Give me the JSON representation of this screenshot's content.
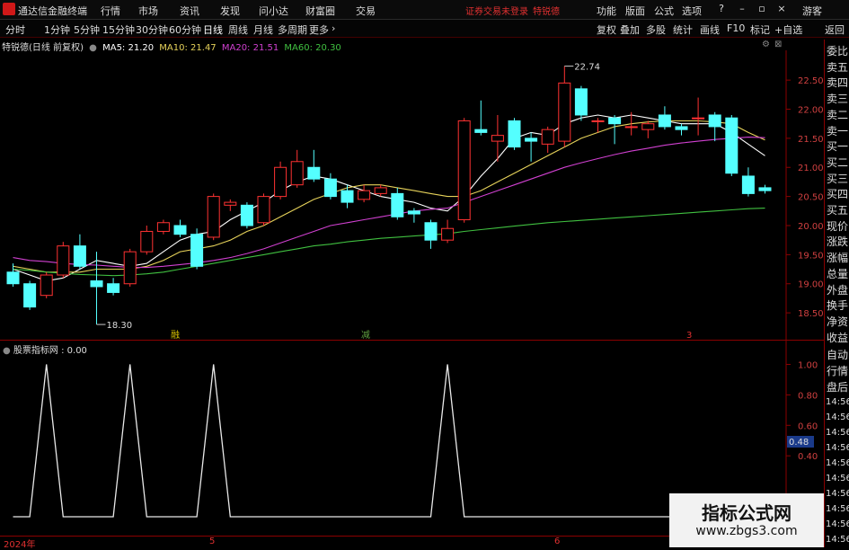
{
  "app": {
    "name": "通达信金融终端",
    "menu": [
      "行情",
      "市场",
      "资讯",
      "发现",
      "问小达",
      "财富圈",
      "交易"
    ],
    "warning": "证券交易未登录",
    "stock_short": "特锐德",
    "right_menu": [
      "功能",
      "版面",
      "公式",
      "选项"
    ],
    "guest": "游客"
  },
  "toolbar": {
    "timeframes": [
      "分时",
      "1分钟",
      "5分钟",
      "15分钟",
      "30分钟",
      "60分钟",
      "日线",
      "周线",
      "月线",
      "多周期",
      "更多"
    ],
    "active": "日线",
    "right": [
      "复权",
      "叠加",
      "多股",
      "统计",
      "画线",
      "F10",
      "标记",
      "+自选",
      "返回"
    ]
  },
  "legend": {
    "title": "特锐德(日线 前复权)",
    "ma5": "MA5: 21.20",
    "ma10": "MA10: 21.47",
    "ma20": "MA20: 21.51",
    "ma60": "MA60: 20.30",
    "colors": {
      "ma5": "#ffffff",
      "ma10": "#e6d25a",
      "ma20": "#d040d0",
      "ma60": "#40c040"
    }
  },
  "price_axis": [
    "22.50",
    "22.00",
    "21.50",
    "21.00",
    "20.50",
    "20.00",
    "19.50",
    "19.00",
    "18.50"
  ],
  "annotations": {
    "high": "22.74",
    "low": "18.30"
  },
  "event_marks": [
    {
      "label": "融",
      "color": "#d8c000"
    },
    {
      "label": "减",
      "color": "#60a040"
    },
    {
      "label": "3",
      "color": "#e03030"
    }
  ],
  "indicator": {
    "title": "股票指标网 : 0.00",
    "axis": [
      "1.00",
      "0.80",
      "0.60",
      "0.40"
    ],
    "current_value": "0.48"
  },
  "date_axis": [
    "2024年",
    "5",
    "6"
  ],
  "sidebar": {
    "top_labels": [
      "委比",
      "卖五",
      "卖四",
      "卖三",
      "卖二",
      "卖一",
      "买一",
      "买二",
      "买三",
      "买四",
      "买五",
      "现价",
      "涨跌",
      "涨幅",
      "总量",
      "外盘",
      "换手",
      "净资",
      "收益"
    ],
    "bottom_labels": [
      "自动",
      "行情",
      "盘后"
    ],
    "times": [
      "14:56",
      "14:56",
      "14:56",
      "14:56",
      "14:56",
      "14:56",
      "14:56",
      "14:56",
      "14:56",
      "14:56"
    ]
  },
  "watermark": {
    "line1": "指标公式网",
    "line2": "www.zbgs3.com"
  },
  "chart_data": {
    "type": "candlestick",
    "ylim": [
      18.1,
      22.95
    ],
    "candles": [
      {
        "o": 19.2,
        "c": 19.0,
        "h": 19.35,
        "l": 18.95
      },
      {
        "o": 19.0,
        "c": 18.6,
        "h": 19.05,
        "l": 18.55
      },
      {
        "o": 18.8,
        "c": 19.15,
        "h": 19.2,
        "l": 18.75
      },
      {
        "o": 19.15,
        "c": 19.65,
        "h": 19.72,
        "l": 19.1
      },
      {
        "o": 19.65,
        "c": 19.3,
        "h": 19.85,
        "l": 19.25
      },
      {
        "o": 19.05,
        "c": 18.95,
        "h": 19.55,
        "l": 18.3
      },
      {
        "o": 19.0,
        "c": 18.85,
        "h": 19.1,
        "l": 18.8
      },
      {
        "o": 19.0,
        "c": 19.55,
        "h": 19.6,
        "l": 18.95
      },
      {
        "o": 19.55,
        "c": 19.9,
        "h": 20.0,
        "l": 19.5
      },
      {
        "o": 19.9,
        "c": 20.05,
        "h": 20.1,
        "l": 19.85
      },
      {
        "o": 20.0,
        "c": 19.85,
        "h": 20.1,
        "l": 19.8
      },
      {
        "o": 19.85,
        "c": 19.3,
        "h": 19.95,
        "l": 19.25
      },
      {
        "o": 19.8,
        "c": 20.5,
        "h": 20.55,
        "l": 19.75
      },
      {
        "o": 20.35,
        "c": 20.4,
        "h": 20.45,
        "l": 20.25
      },
      {
        "o": 20.35,
        "c": 20.0,
        "h": 20.4,
        "l": 19.95
      },
      {
        "o": 20.05,
        "c": 20.5,
        "h": 20.55,
        "l": 20.0
      },
      {
        "o": 20.5,
        "c": 21.0,
        "h": 21.1,
        "l": 20.45
      },
      {
        "o": 20.7,
        "c": 21.1,
        "h": 21.3,
        "l": 20.65
      },
      {
        "o": 21.0,
        "c": 20.8,
        "h": 21.3,
        "l": 20.75
      },
      {
        "o": 20.8,
        "c": 20.5,
        "h": 20.9,
        "l": 20.45
      },
      {
        "o": 20.6,
        "c": 20.4,
        "h": 20.7,
        "l": 20.3
      },
      {
        "o": 20.45,
        "c": 20.6,
        "h": 20.7,
        "l": 20.4
      },
      {
        "o": 20.55,
        "c": 20.65,
        "h": 20.7,
        "l": 20.5
      },
      {
        "o": 20.55,
        "c": 20.15,
        "h": 20.65,
        "l": 20.1
      },
      {
        "o": 20.25,
        "c": 20.2,
        "h": 20.3,
        "l": 20.05
      },
      {
        "o": 20.05,
        "c": 19.75,
        "h": 20.1,
        "l": 19.6
      },
      {
        "o": 19.75,
        "c": 19.95,
        "h": 20.1,
        "l": 19.7
      },
      {
        "o": 20.1,
        "c": 21.8,
        "h": 21.85,
        "l": 20.05
      },
      {
        "o": 21.65,
        "c": 21.6,
        "h": 22.15,
        "l": 21.55
      },
      {
        "o": 21.45,
        "c": 21.55,
        "h": 21.9,
        "l": 21.1
      },
      {
        "o": 21.8,
        "c": 21.35,
        "h": 21.85,
        "l": 21.3
      },
      {
        "o": 21.5,
        "c": 21.45,
        "h": 21.6,
        "l": 21.1
      },
      {
        "o": 21.4,
        "c": 21.65,
        "h": 21.7,
        "l": 21.25
      },
      {
        "o": 21.45,
        "c": 22.45,
        "h": 22.74,
        "l": 21.35
      },
      {
        "o": 22.35,
        "c": 21.9,
        "h": 22.4,
        "l": 21.8
      },
      {
        "o": 21.8,
        "c": 21.8,
        "h": 21.85,
        "l": 21.6
      },
      {
        "o": 21.85,
        "c": 21.75,
        "h": 21.9,
        "l": 21.4
      },
      {
        "o": 21.7,
        "c": 21.7,
        "h": 21.95,
        "l": 21.55
      },
      {
        "o": 21.65,
        "c": 21.75,
        "h": 21.8,
        "l": 21.5
      },
      {
        "o": 21.9,
        "c": 21.7,
        "h": 22.05,
        "l": 21.65
      },
      {
        "o": 21.7,
        "c": 21.65,
        "h": 21.75,
        "l": 21.55
      },
      {
        "o": 21.85,
        "c": 21.85,
        "h": 22.2,
        "l": 21.55
      },
      {
        "o": 21.9,
        "c": 21.7,
        "h": 21.95,
        "l": 21.45
      },
      {
        "o": 21.85,
        "c": 20.9,
        "h": 21.9,
        "l": 20.85
      },
      {
        "o": 20.85,
        "c": 20.55,
        "h": 21.0,
        "l": 20.5
      },
      {
        "o": 20.65,
        "c": 20.6,
        "h": 20.7,
        "l": 20.55
      }
    ],
    "ma": [
      {
        "name": "MA5",
        "color": "#ffffff",
        "values": [
          19.25,
          19.15,
          19.05,
          19.1,
          19.25,
          19.4,
          19.35,
          19.3,
          19.35,
          19.55,
          19.75,
          19.85,
          19.9,
          20.1,
          20.25,
          20.4,
          20.6,
          20.75,
          20.85,
          20.8,
          20.7,
          20.6,
          20.5,
          20.45,
          20.4,
          20.3,
          20.25,
          20.5,
          20.85,
          21.15,
          21.5,
          21.6,
          21.55,
          21.75,
          21.85,
          21.9,
          21.85,
          21.9,
          21.85,
          21.8,
          21.75,
          21.75,
          21.75,
          21.6,
          21.4,
          21.2
        ]
      },
      {
        "name": "MA10",
        "color": "#e6d25a",
        "values": [
          19.3,
          19.25,
          19.2,
          19.2,
          19.2,
          19.25,
          19.25,
          19.25,
          19.3,
          19.4,
          19.55,
          19.6,
          19.65,
          19.75,
          19.9,
          20.0,
          20.15,
          20.3,
          20.45,
          20.55,
          20.65,
          20.7,
          20.7,
          20.65,
          20.6,
          20.55,
          20.5,
          20.5,
          20.6,
          20.75,
          20.9,
          21.05,
          21.2,
          21.35,
          21.5,
          21.6,
          21.7,
          21.75,
          21.78,
          21.8,
          21.8,
          21.8,
          21.78,
          21.75,
          21.6,
          21.47
        ]
      },
      {
        "name": "MA20",
        "color": "#d040d0",
        "values": [
          19.45,
          19.4,
          19.38,
          19.35,
          19.33,
          19.32,
          19.3,
          19.28,
          19.28,
          19.3,
          19.33,
          19.36,
          19.4,
          19.45,
          19.52,
          19.6,
          19.7,
          19.8,
          19.9,
          20.0,
          20.05,
          20.1,
          20.15,
          20.2,
          20.25,
          20.28,
          20.3,
          20.4,
          20.5,
          20.6,
          20.7,
          20.8,
          20.9,
          21.0,
          21.08,
          21.15,
          21.22,
          21.28,
          21.33,
          21.38,
          21.42,
          21.45,
          21.48,
          21.5,
          21.52,
          21.51
        ]
      },
      {
        "name": "MA60",
        "color": "#40c040",
        "values": [
          19.25,
          19.23,
          19.2,
          19.18,
          19.16,
          19.15,
          19.14,
          19.15,
          19.17,
          19.2,
          19.25,
          19.3,
          19.35,
          19.4,
          19.45,
          19.5,
          19.55,
          19.6,
          19.65,
          19.68,
          19.72,
          19.75,
          19.78,
          19.8,
          19.82,
          19.84,
          19.86,
          19.9,
          19.93,
          19.96,
          19.99,
          20.02,
          20.05,
          20.07,
          20.09,
          20.11,
          20.13,
          20.15,
          20.17,
          20.19,
          20.21,
          20.23,
          20.25,
          20.27,
          20.29,
          20.3
        ]
      }
    ],
    "indicator_series": {
      "name": "股票指标网",
      "ylim": [
        0,
        1.05
      ],
      "values": [
        0,
        0,
        1,
        0,
        0,
        0,
        0,
        1,
        0,
        0,
        0,
        0,
        1,
        0,
        0,
        0,
        0,
        0,
        0,
        0,
        0,
        0,
        0,
        0,
        0,
        0,
        1,
        0,
        0,
        0,
        0,
        0,
        0,
        0,
        0,
        0,
        0,
        0,
        0,
        0,
        0,
        0,
        0,
        0,
        0,
        0
      ]
    }
  }
}
